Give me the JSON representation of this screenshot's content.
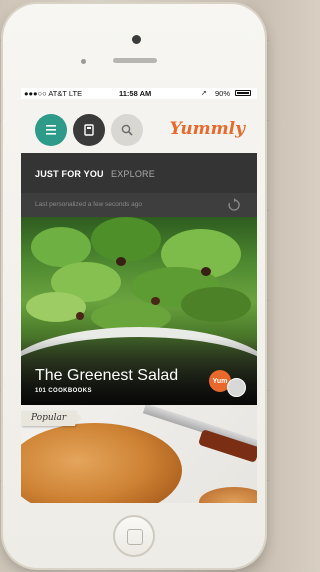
{
  "status_bar": {
    "carrier": "●●●○○ AT&T  LTE",
    "time": "11:58 AM",
    "battery": "90%"
  },
  "header": {
    "menu_icon": "menu-icon",
    "saved_icon": "bookmark-icon",
    "search_icon": "search-icon",
    "logo": "Yummly"
  },
  "tabs": [
    {
      "label": "JUST FOR YOU",
      "active": true
    },
    {
      "label": "EXPLORE",
      "active": false
    }
  ],
  "feed_status": "Last personalized a few seconds ago",
  "featured": {
    "title": "The Greenest Salad",
    "subtitle": "101 COOKBOOKS",
    "badge": "Yum"
  },
  "second_card": {
    "ribbon": "Popular"
  },
  "colors": {
    "brand_orange": "#e8692b",
    "teal_button": "#2e9a8a",
    "dark_button": "#3a3a3a",
    "light_button": "#d9d7d2",
    "tab_bar": "#343434"
  }
}
